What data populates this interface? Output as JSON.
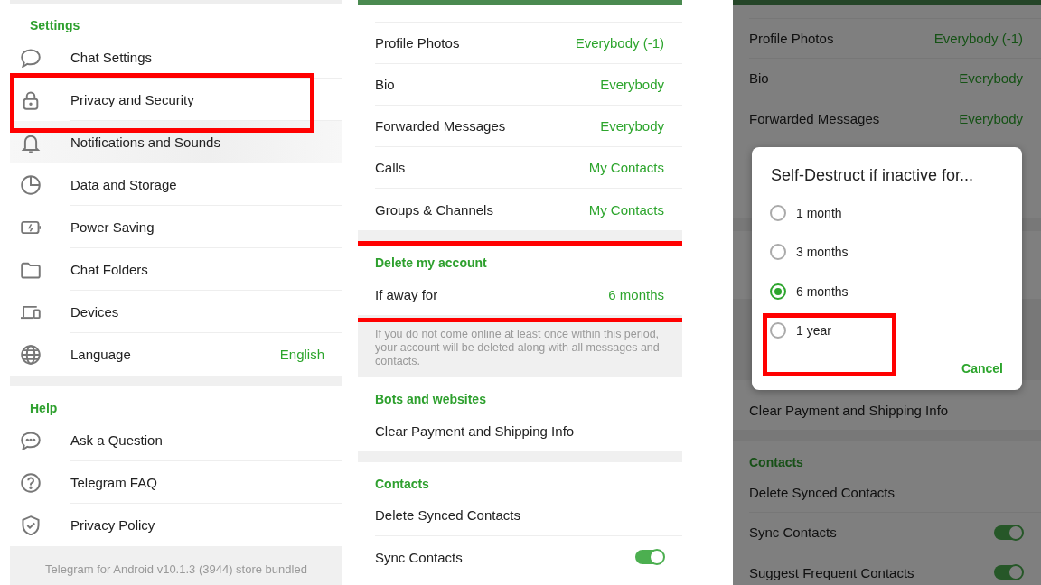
{
  "panels": [
    {
      "kind": "main",
      "sections": [
        {
          "header": "Settings",
          "items": [
            {
              "label": "Chat Settings",
              "pressed": false
            },
            {
              "label": "Privacy and Security",
              "pressed": false,
              "highlighted": true
            },
            {
              "label": "Notifications and Sounds",
              "pressed": true
            },
            {
              "label": "Data and Storage",
              "pressed": false
            },
            {
              "label": "Power Saving",
              "pressed": false
            },
            {
              "label": "Chat Folders",
              "pressed": false
            },
            {
              "label": "Devices",
              "pressed": false
            },
            {
              "label": "Language",
              "value": "English",
              "pressed": false
            }
          ]
        },
        {
          "header": "Help",
          "items": [
            {
              "label": "Ask a Question",
              "pressed": false
            },
            {
              "label": "Telegram FAQ",
              "pressed": false
            },
            {
              "label": "Privacy Policy",
              "pressed": false
            }
          ]
        }
      ],
      "footer": "Telegram for Android v10.1.3 (3944) store bundled"
    },
    {
      "kind": "privacy",
      "sections": [
        {
          "items": [
            {
              "label": "Profile Photos",
              "value": "Everybody (-1)"
            },
            {
              "label": "Bio",
              "value": "Everybody"
            },
            {
              "label": "Forwarded Messages",
              "value": "Everybody"
            },
            {
              "label": "Calls",
              "value": "My Contacts"
            },
            {
              "label": "Groups & Channels",
              "value": "My Contacts"
            }
          ]
        },
        {
          "header": "Delete my account",
          "highlighted": true,
          "items": [
            {
              "label": "If away for",
              "value": "6 months"
            }
          ],
          "info": "If you do not come online at least once within this period, your account will be deleted along with all messages and contacts."
        },
        {
          "header": "Bots and websites",
          "items": [
            {
              "label": "Clear Payment and Shipping Info"
            }
          ]
        },
        {
          "header": "Contacts",
          "items": [
            {
              "label": "Delete Synced Contacts"
            },
            {
              "label": "Sync Contacts",
              "kind": "toggle",
              "on": true
            }
          ]
        }
      ]
    },
    {
      "kind": "privacy_dialog",
      "sections_top": [
        {
          "items": [
            {
              "label": "Profile Photos",
              "value": "Everybody (-1)"
            },
            {
              "label": "Bio",
              "value": "Everybody"
            },
            {
              "label": "Forwarded Messages",
              "value": "Everybody"
            }
          ]
        }
      ],
      "dialog": {
        "title": "Self-Destruct if inactive for...",
        "options": [
          {
            "label": "1 month",
            "selected": false
          },
          {
            "label": "3 months",
            "selected": false
          },
          {
            "label": "6 months",
            "selected": true
          },
          {
            "label": "1 year",
            "selected": false,
            "highlighted": true
          }
        ],
        "button": "Cancel"
      },
      "sections_bottom": [
        {
          "items": [
            {
              "label": "Clear Payment and Shipping Info"
            }
          ]
        },
        {
          "header": "Contacts",
          "items": [
            {
              "label": "Delete Synced Contacts"
            },
            {
              "label": "Sync Contacts",
              "kind": "toggle",
              "on": true
            },
            {
              "label": "Suggest Frequent Contacts",
              "kind": "toggle",
              "on": true
            }
          ]
        }
      ]
    }
  ]
}
